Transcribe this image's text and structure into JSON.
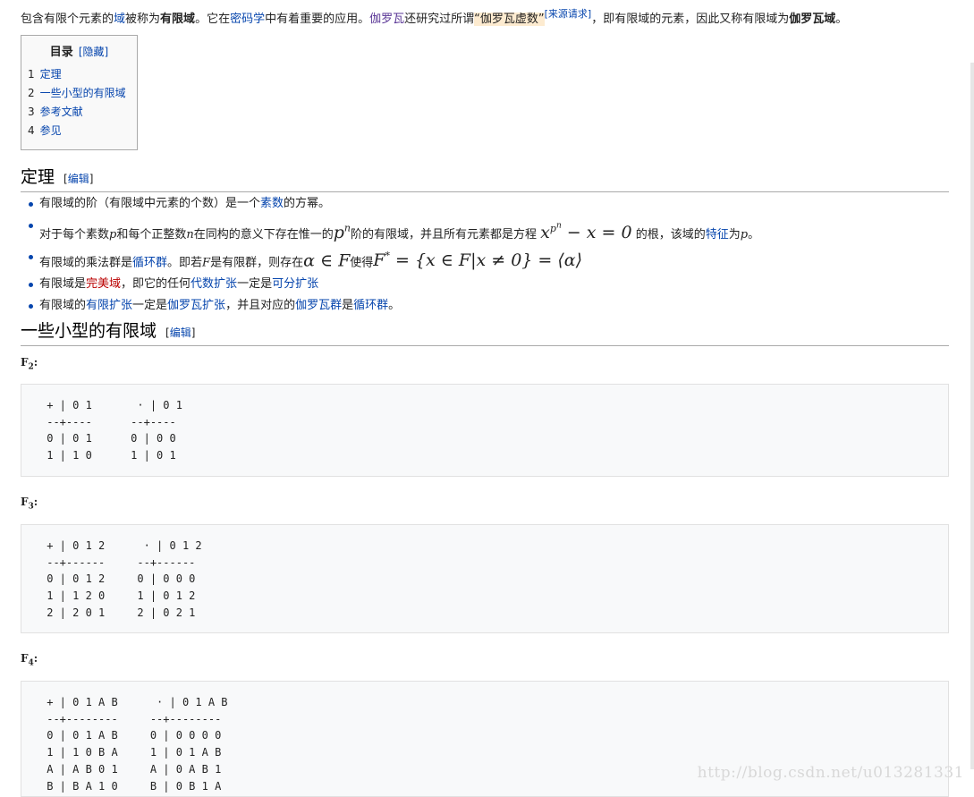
{
  "intro": {
    "p1": "包含有限个元素的",
    "l_field": "域",
    "p2": "被称为",
    "b_finite": "有限域",
    "p3": "。它在",
    "l_crypto": "密码学",
    "p4": "中有着重要的应用。",
    "l_galois": "伽罗瓦",
    "p5": "还研究过所谓",
    "hl_imag": "“伽罗瓦虚数”",
    "citation": "[来源请求]",
    "p6": "，即有限域的元素，因此又称有限域为",
    "b_gf": "伽罗瓦域",
    "p7": "。"
  },
  "toc": {
    "title": "目录",
    "toggle": "[隐藏]",
    "items": [
      {
        "num": "1",
        "label": "定理"
      },
      {
        "num": "2",
        "label": "一些小型的有限域"
      },
      {
        "num": "3",
        "label": "参考文献"
      },
      {
        "num": "4",
        "label": "参见"
      }
    ]
  },
  "sections": {
    "theorem": {
      "title": "定理",
      "edit_open": "[",
      "edit": "编辑",
      "edit_close": "]"
    },
    "small": {
      "title": "一些小型的有限域",
      "edit_open": "[",
      "edit": "编辑",
      "edit_close": "]"
    }
  },
  "bullets": {
    "b1": {
      "t1": "有限域的阶（有限域中元素的个数）是一个",
      "l1": "素数",
      "t2": "的方幂。"
    },
    "b2": {
      "t1": "对于每个素数",
      "p": "p",
      "t2": "和每个正整数",
      "n": "n",
      "t3": "在同构的意义下存在惟一的",
      "m1": "p",
      "m1sup": "n",
      "t4": "阶的有限域，并且所有元素都是方程",
      "m2": "x",
      "m2sup": "p",
      "m2supsup": "n",
      "m2rest": " − x = 0",
      "t5": "的根，该域的",
      "l1": "特征",
      "t6": "为",
      "p2": "p",
      "t7": "。"
    },
    "b3": {
      "t1": "有限域的乘法群是",
      "l1": "循环群",
      "t2": "。即若",
      "f": "F",
      "t3": "是有限群，则存在",
      "m1": "α ∈ F",
      "t4": "使得",
      "m2": "F",
      "m2sup": "*",
      "m2rest": " = {x ∈ F|x ≠ 0} = ⟨α⟩"
    },
    "b4": {
      "t1": "有限域是",
      "l1": "完美域",
      "t2": "，即它的任何",
      "l2": "代数扩张",
      "t3": "一定是",
      "l3": "可分扩张"
    },
    "b5": {
      "t1": "有限域的",
      "l1": "有限扩张",
      "t2": "一定是",
      "l2": "伽罗瓦扩张",
      "t3": "，并且对应的",
      "l3": "伽罗瓦群",
      "t4": "是",
      "l4": "循环群",
      "t5": "。"
    }
  },
  "fields": [
    {
      "F": "F",
      "sub": "2",
      "colon": ":",
      "table": " + | 0 1       · | 0 1\n --+----      --+----\n 0 | 0 1      0 | 0 0\n 1 | 1 0      1 | 0 1"
    },
    {
      "F": "F",
      "sub": "3",
      "colon": ":",
      "table": " + | 0 1 2      · | 0 1 2\n --+------     --+------\n 0 | 0 1 2     0 | 0 0 0\n 1 | 1 2 0     1 | 0 1 2\n 2 | 2 0 1     2 | 0 2 1"
    },
    {
      "F": "F",
      "sub": "4",
      "colon": ":",
      "table": " + | 0 1 A B      · | 0 1 A B\n --+--------     --+--------\n 0 | 0 1 A B     0 | 0 0 0 0\n 1 | 1 0 B A     1 | 0 1 A B\n A | A B 0 1     A | 0 A B 1\n B | B A 1 0     B | 0 B 1 A"
    }
  ],
  "watermark": "http://blog.csdn.net/u013281331"
}
